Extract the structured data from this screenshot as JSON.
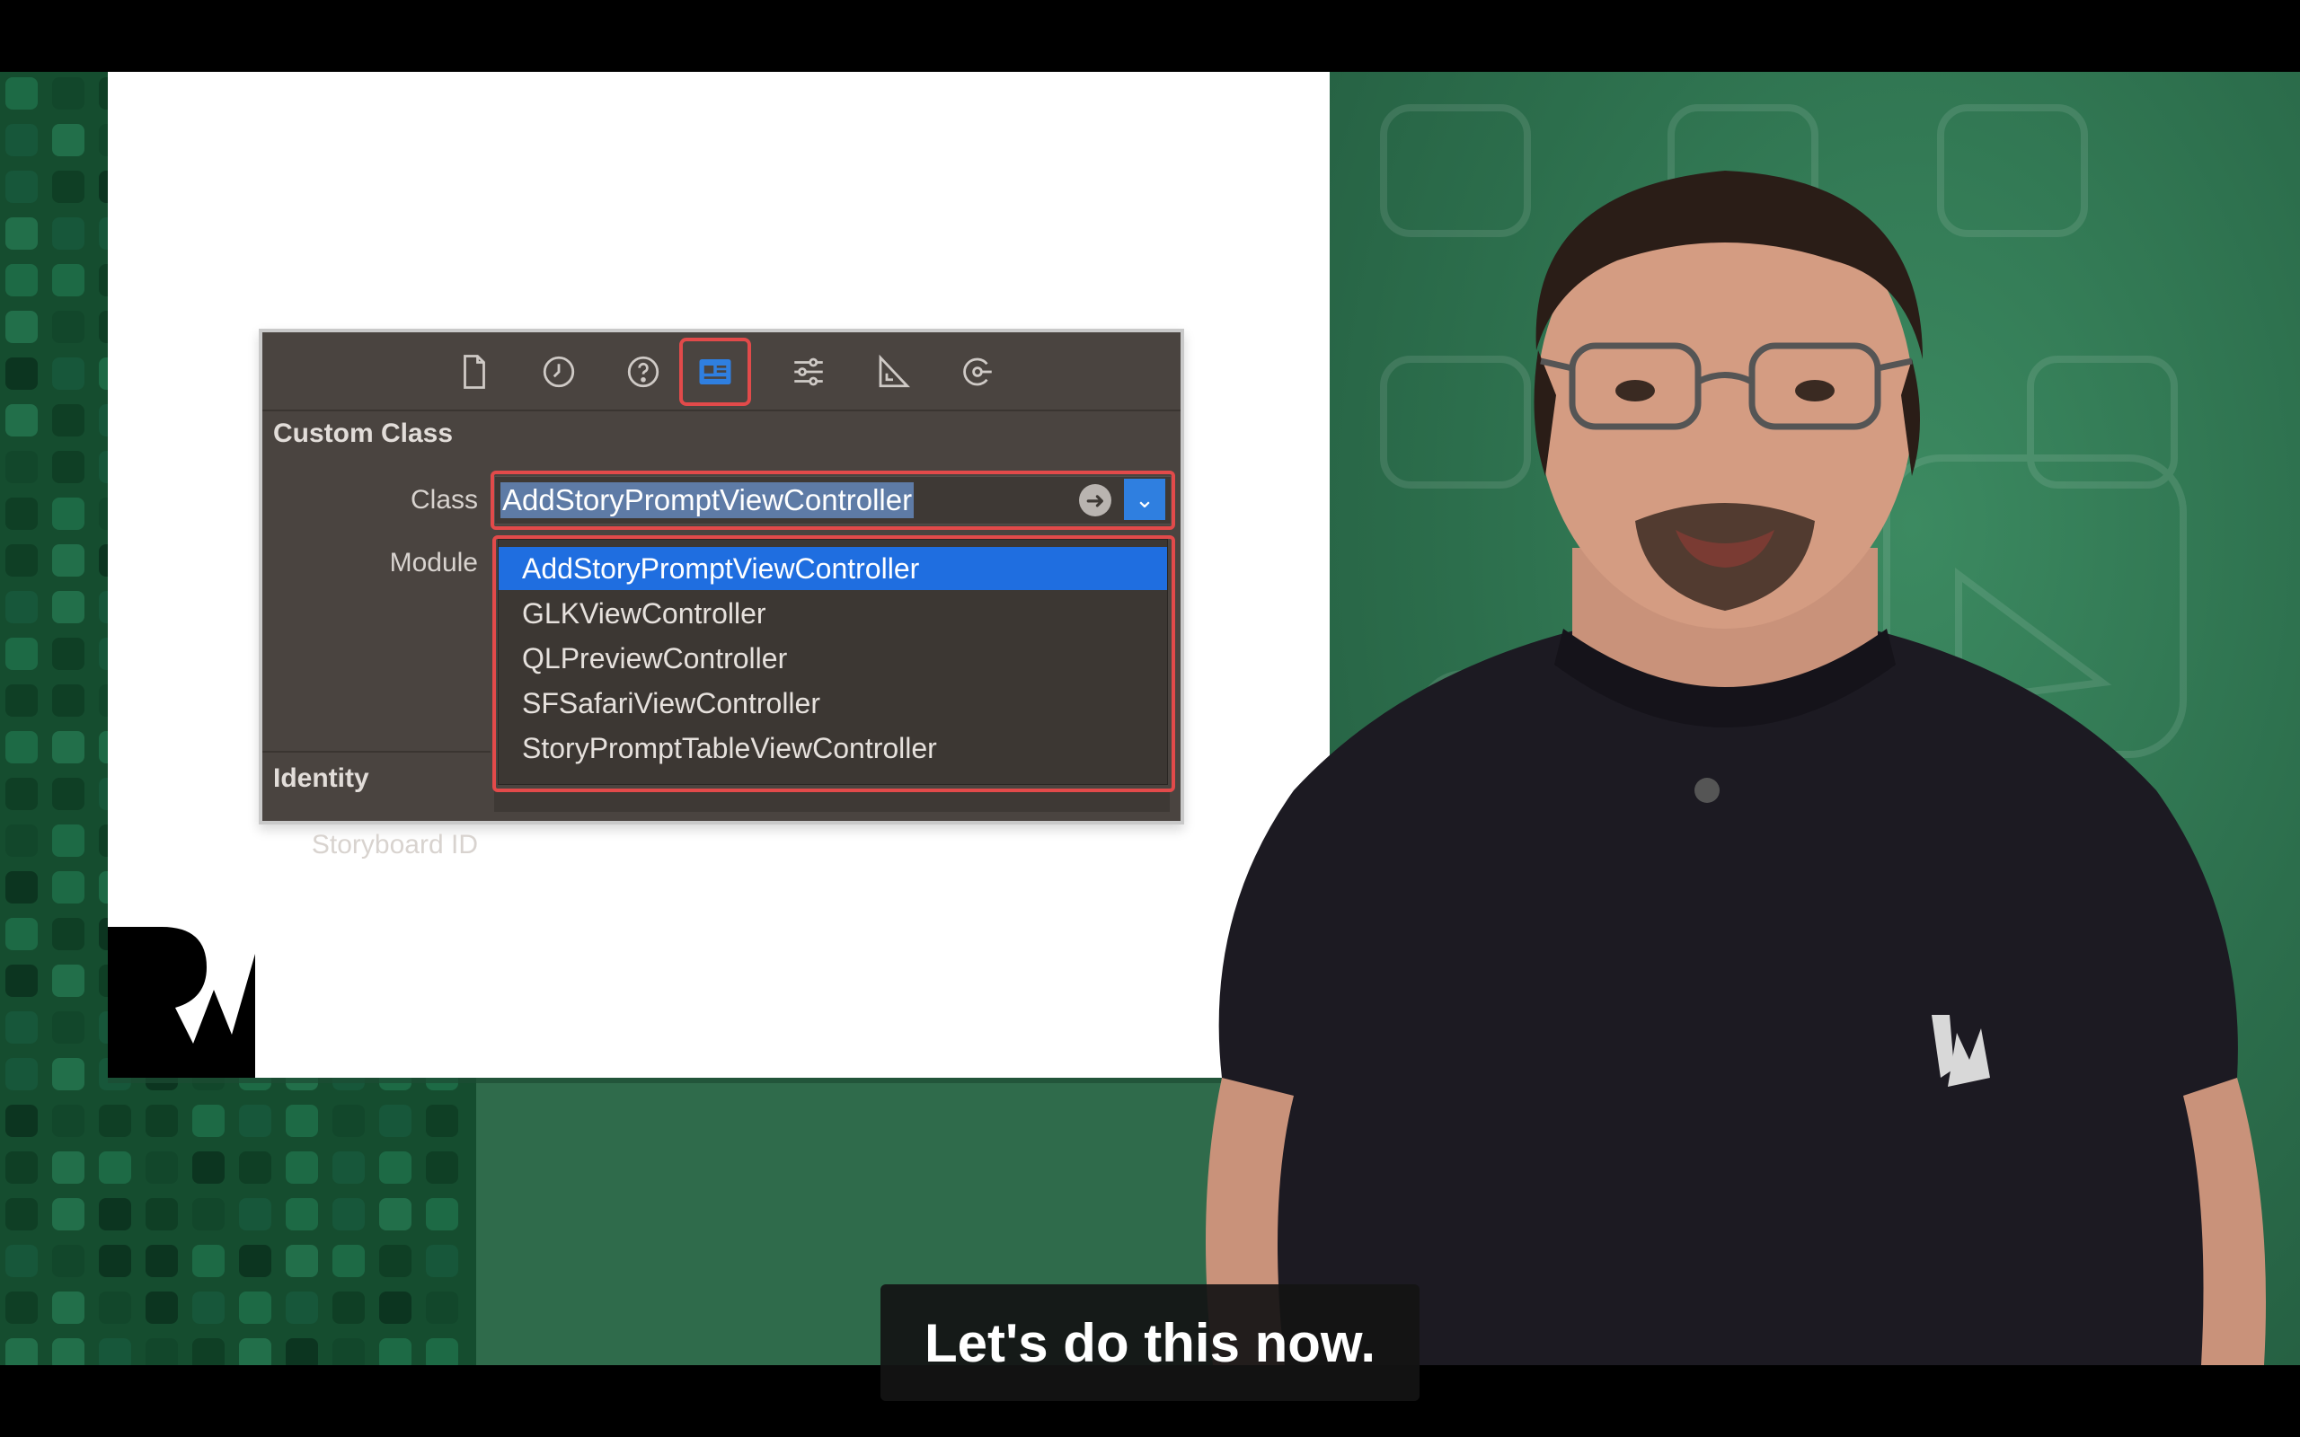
{
  "inspector": {
    "toolbar_icons": [
      "file-icon",
      "clock-icon",
      "help-icon",
      "identity-inspector-icon",
      "attributes-icon",
      "size-icon",
      "connections-icon"
    ],
    "active_tab": "identity-inspector-icon",
    "section_custom_class": "Custom Class",
    "class_label": "Class",
    "class_value": "AddStoryPromptViewController",
    "module_label": "Module",
    "section_identity": "Identity",
    "storyboard_id_label": "Storyboard ID",
    "dropdown_options": [
      "AddStoryPromptViewController",
      "GLKViewController",
      "QLPreviewController",
      "SFSafariViewController",
      "StoryPromptTableViewController"
    ],
    "selected_option_index": 0,
    "accent_color": "#1f6ee0",
    "highlight_color": "#e24a4a"
  },
  "subtitle": {
    "text": "Let's do this now."
  }
}
